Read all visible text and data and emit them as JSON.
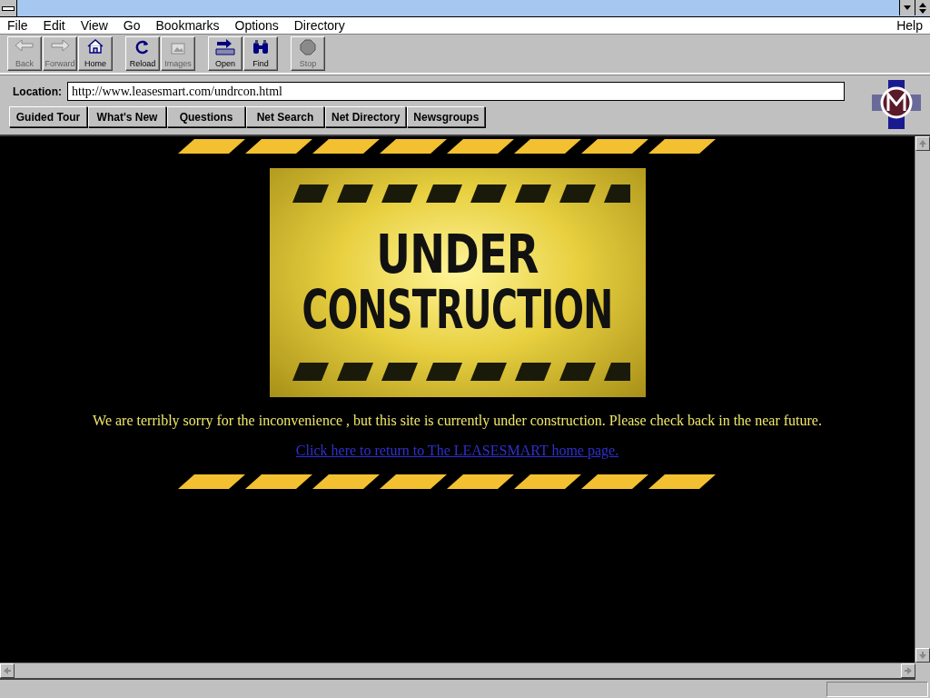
{
  "menu": [
    "File",
    "Edit",
    "View",
    "Go",
    "Bookmarks",
    "Options",
    "Directory"
  ],
  "help_menu": "Help",
  "toolbar": [
    {
      "label": "Back",
      "disabled": true
    },
    {
      "label": "Forward",
      "disabled": true
    },
    {
      "label": "Home",
      "disabled": false
    },
    {
      "label": "Reload",
      "disabled": false
    },
    {
      "label": "Images",
      "disabled": true
    },
    {
      "label": "Open",
      "disabled": false
    },
    {
      "label": "Find",
      "disabled": false
    },
    {
      "label": "Stop",
      "disabled": true
    }
  ],
  "location": {
    "label": "Location:",
    "value": "http://www.leasesmart.com/undrcon.html"
  },
  "directory_buttons": [
    "Guided Tour",
    "What's New",
    "Questions",
    "Net Search",
    "Net Directory",
    "Newsgroups"
  ],
  "page": {
    "sign": [
      "UNDER",
      "CONSTRUCTION"
    ],
    "message": "We are terribly sorry for the inconvenience , but this site is currently under construction. Please check back in the near future.",
    "link": "Click here to return to The LEASESMART home page."
  }
}
